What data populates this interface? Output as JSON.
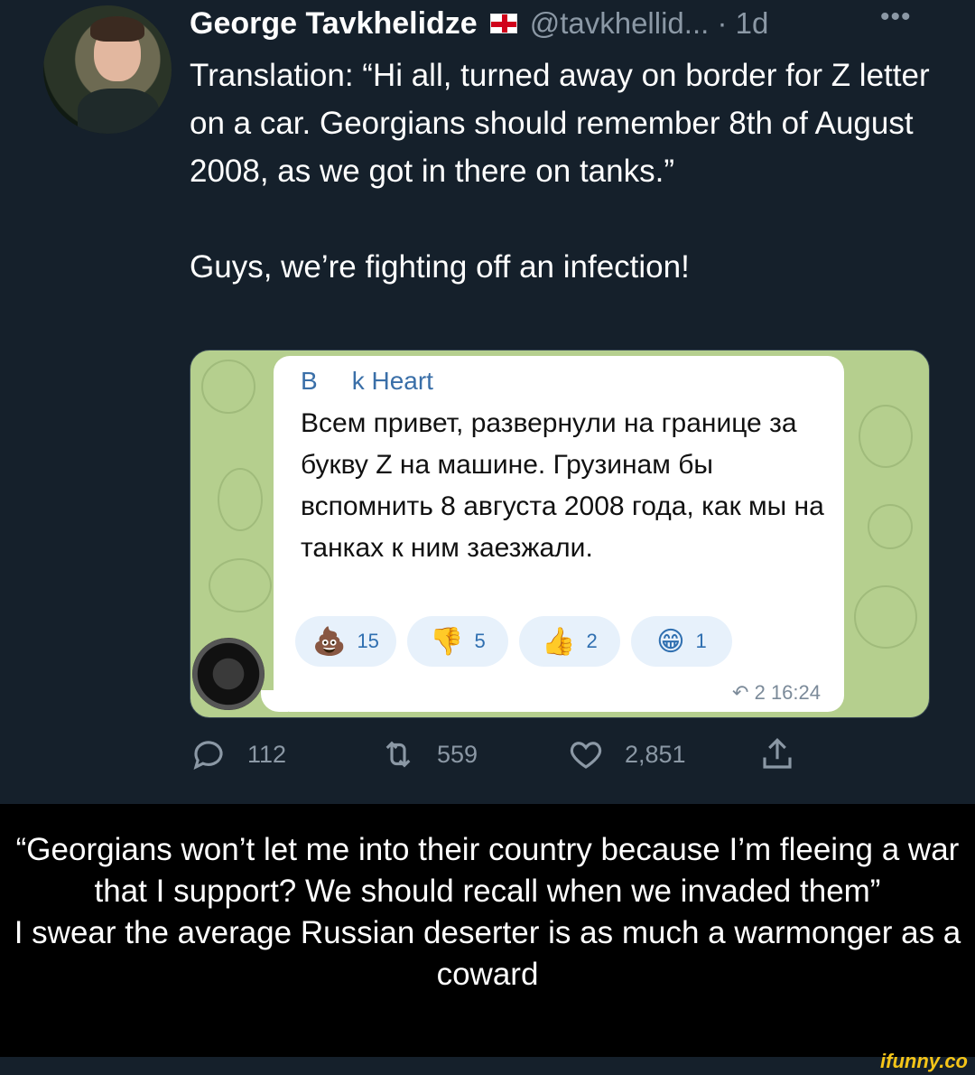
{
  "tweet": {
    "author_name": "George Tavkhelidze",
    "handle_time": "@tavkhellid... · 1d",
    "more_icon": "more-horizontal-icon",
    "flag_icon": "georgia-flag-icon",
    "body_line1": "Translation: “Hi all, turned away on border for Z letter on a car. Georgians should remember 8th of August 2008, as we got in there on tanks.”",
    "body_line2": "Guys, we’re fighting off an infection!",
    "actions": {
      "reply_count": "112",
      "retweet_count": "559",
      "like_count": "2,851",
      "reply_icon": "reply-bubble-icon",
      "retweet_icon": "retweet-icon",
      "like_icon": "heart-icon",
      "share_icon": "share-icon"
    }
  },
  "telegram": {
    "sender_initial": "B",
    "sender_name": "k Heart",
    "message": "Всем привет, развернули на границе за букву Z на машине. Грузинам бы вспомнить 8 августа 2008 года, как мы на танках к ним заезжали.",
    "reactions": [
      {
        "emoji": "💩",
        "icon": "poop-emoji-icon",
        "count": "15"
      },
      {
        "emoji": "👎",
        "icon": "thumbs-down-icon",
        "count": "5"
      },
      {
        "emoji": "👍",
        "icon": "thumbs-up-icon",
        "count": "2"
      },
      {
        "emoji": "😁",
        "icon": "grin-emoji-icon",
        "count": "1"
      }
    ],
    "meta": "↶ 2 16:24"
  },
  "caption": {
    "line1": "“Georgians won’t let me into their country because I’m fleeing a war that I support? We should recall when we invaded them”",
    "line2": "I swear the average Russian deserter is as much a warmonger as a coward"
  },
  "watermark": "ifunny.co",
  "colors": {
    "tweet_bg": "#15202b",
    "secondary_text": "#8b98a5",
    "telegram_bg": "#b5cf8e",
    "telegram_link": "#3a6fa8",
    "caption_bg": "#000000",
    "watermark": "#f5c518"
  }
}
